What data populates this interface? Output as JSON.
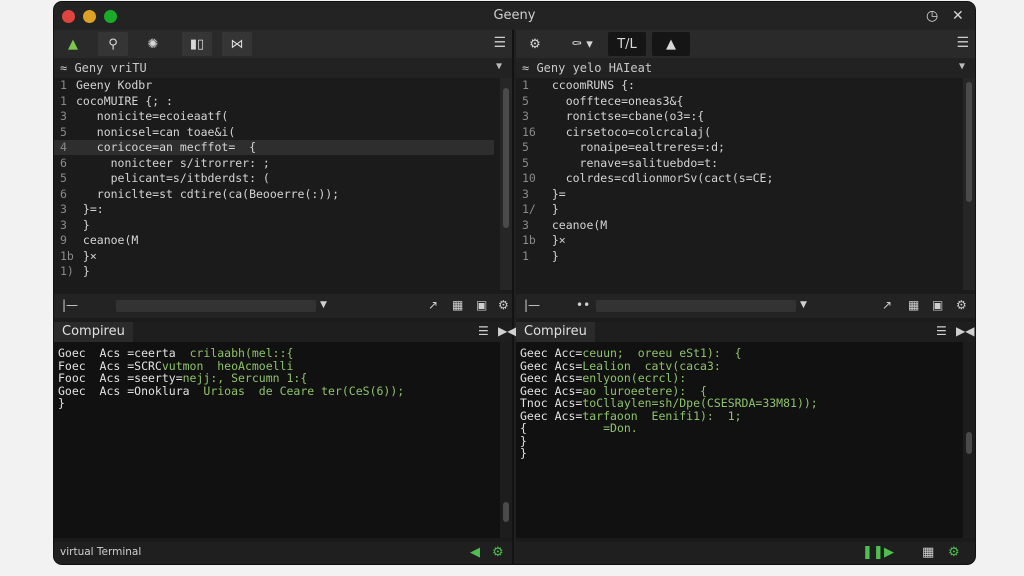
{
  "window": {
    "title": "Geeny",
    "clock_icon": "clock-icon",
    "close_icon": "close-icon"
  },
  "left": {
    "toolbar": {
      "icons": [
        "compile-icon",
        "search-icon",
        "debug-icon",
        "split-icon",
        "expand-icon"
      ]
    },
    "tab_label": "≈ Geny   vriTU",
    "code": [
      {
        "n": "1",
        "t": "Geeny Kodbr"
      },
      {
        "n": "1",
        "t": "cocoMUIRE {; :"
      },
      {
        "n": "3",
        "t": "   nonicite=ecoieaatf("
      },
      {
        "n": "5",
        "t": "   nonicsel=can toae&i("
      },
      {
        "n": "4",
        "t": "   coricoce=an mecffot=  {"
      },
      {
        "n": "6",
        "t": "     nonicteer s/itrorrer: ;"
      },
      {
        "n": "5",
        "t": "     pelicant=s/itbderdst: ("
      },
      {
        "n": "6",
        "t": "   roniclte=st cdtire(ca(Beooerre(:));"
      },
      {
        "n": "3",
        "t": " }=:"
      },
      {
        "n": "3",
        "t": " }"
      },
      {
        "n": "9",
        "t": " ceanoe(M"
      },
      {
        "n": "1b",
        "t": " }×"
      },
      {
        "n": "1)",
        "t": " }"
      }
    ],
    "console_title": "Compireu",
    "console": [
      {
        "a": "Goec  Acs =ceerta  ",
        "b": "crilaabh(mel::{"
      },
      {
        "a": "Foec  Acs =SCRC",
        "b": "vutmon  heoAcmoelli"
      },
      {
        "a": "Fooc  Acs =seerty=",
        "b": "nejj:, Sercumn 1:{"
      },
      {
        "a": "Goec  Acs =Onoklura  ",
        "b": "Urioas  de Ceare ter(CeS(6));"
      },
      {
        "a": "}",
        "b": ""
      }
    ],
    "status_text": "virtual Terminal"
  },
  "right": {
    "toolbar": {
      "icons": [
        "gear-icon",
        "bug-icon",
        "tab-icon",
        "warning-icon"
      ],
      "tab_text": "T/L"
    },
    "tab_label": "≈ Geny   yelo HAIeat",
    "code": [
      {
        "n": "1",
        "t": "  ccoomRUNS {:"
      },
      {
        "n": "5",
        "t": "    oofftece=oneas3&{"
      },
      {
        "n": "3",
        "t": "    ronictse=cbane(o3=:{"
      },
      {
        "n": "16",
        "t": "    cirsetoco=colcrcalaj("
      },
      {
        "n": "5",
        "t": "      ronaipe=ealtreres=:d;"
      },
      {
        "n": "5",
        "t": "      renave=salituebdo=t:"
      },
      {
        "n": "10",
        "t": "    colrdes=cdlionmorSv(cact(s=CE;"
      },
      {
        "n": "3",
        "t": "  }="
      },
      {
        "n": "1/",
        "t": "  }"
      },
      {
        "n": "3",
        "t": "  ceanoe(M"
      },
      {
        "n": "1b",
        "t": "  }×"
      },
      {
        "n": "1",
        "t": "  }"
      }
    ],
    "console_title": "Compireu",
    "console": [
      {
        "a": "Geec Acc=",
        "b": "ceuun;  oreeu eSt1):  {"
      },
      {
        "a": "Geec Acs=",
        "b": "Lealion  catv(caca3:"
      },
      {
        "a": "Geec Acs=",
        "b": "enlyoon(ecrcl):"
      },
      {
        "a": "Geec Acs=",
        "b": "ao luroeetere):  {"
      },
      {
        "a": "Tnoc Acs=",
        "b": "toCllaylen=sh/Dpe(CSESRDA=33M81));"
      },
      {
        "a": "Geec Acs=",
        "b": "tarfaoon  Eenifi1):  1;"
      },
      {
        "a": "{",
        "b": "           =Don."
      },
      {
        "a": "}",
        "b": ""
      },
      {
        "a": "}",
        "b": ""
      }
    ]
  }
}
